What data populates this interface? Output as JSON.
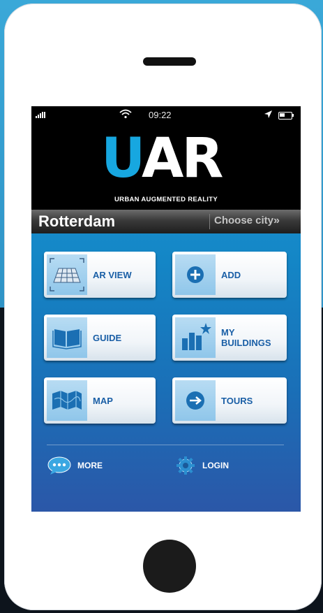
{
  "status_bar": {
    "time": "09:22"
  },
  "header": {
    "logo_u": "U",
    "logo_ar": "AR",
    "tagline": "URBAN AUGMENTED REALITY"
  },
  "city_bar": {
    "city": "Rotterdam",
    "choose_label": "Choose city",
    "choose_arrow": "»"
  },
  "menu": {
    "ar_view": "AR VIEW",
    "add": "ADD",
    "guide": "GUIDE",
    "my_buildings_line1": "MY",
    "my_buildings_line2": "BUILDINGS",
    "map": "MAP",
    "tours": "TOURS"
  },
  "bottom": {
    "more": "MORE",
    "login": "LOGIN"
  },
  "colors": {
    "brand_blue": "#17a7e0",
    "label_blue": "#1a5fa6",
    "screen_top": "#1f9bd6",
    "screen_bottom": "#2b57a8"
  },
  "icons": [
    "signal-icon",
    "wifi-icon",
    "location-arrow-icon",
    "battery-icon",
    "ar-grid-icon",
    "plus-icon",
    "book-icon",
    "buildings-icon",
    "map-icon",
    "arrow-right-icon",
    "chat-bubble-icon",
    "gear-icon"
  ]
}
